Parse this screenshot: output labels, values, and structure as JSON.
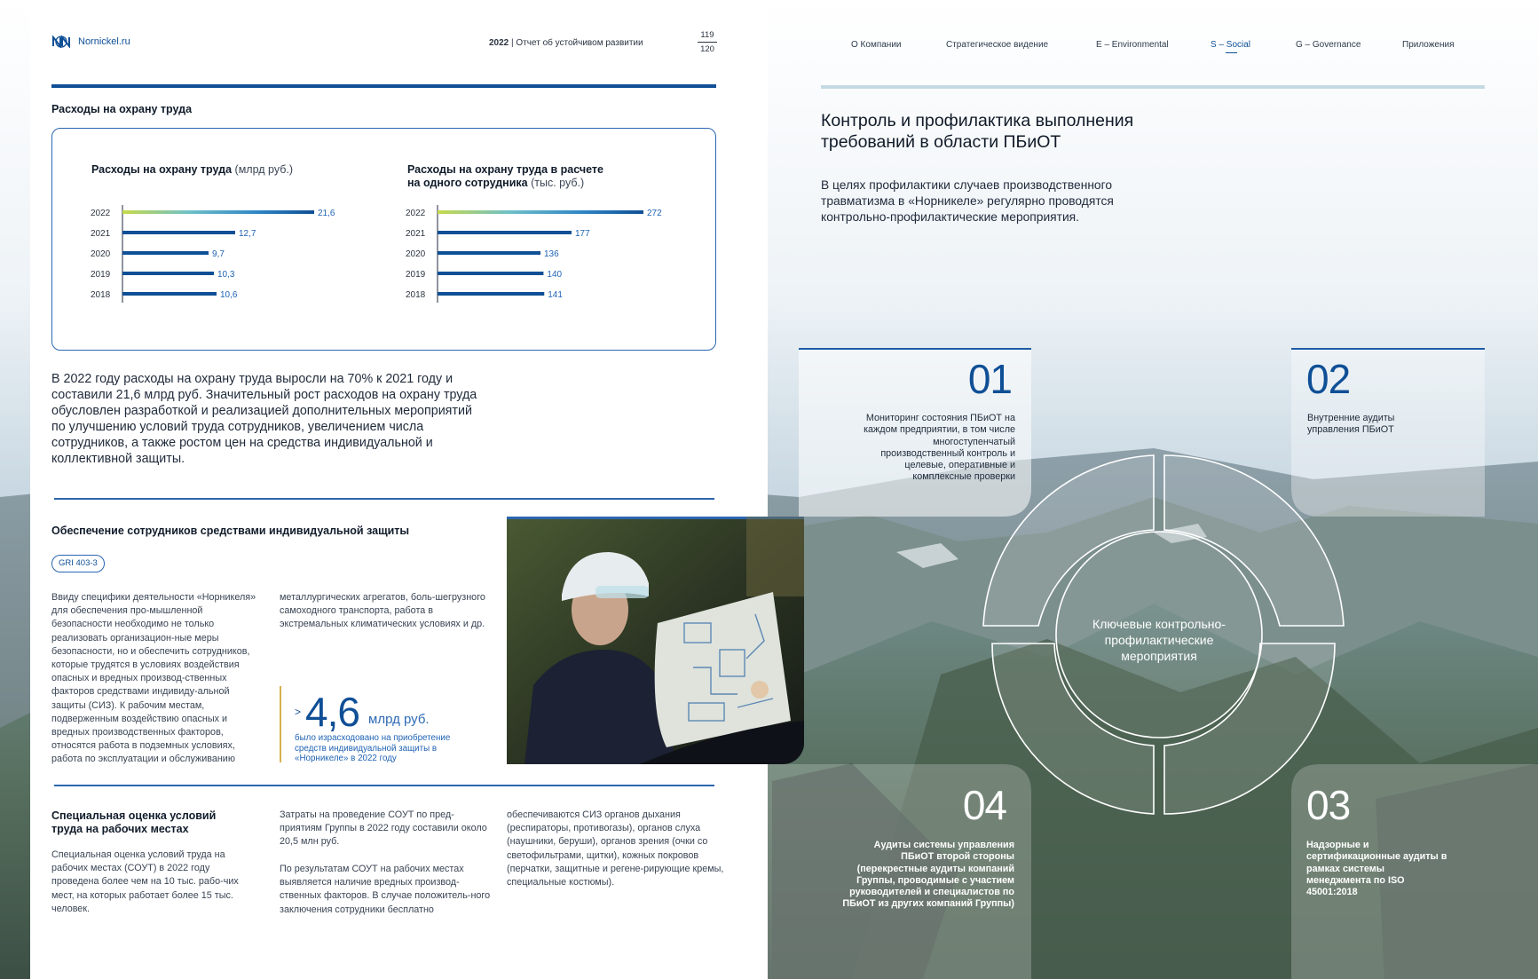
{
  "header": {
    "site": "Nornickel.ru",
    "report_year": "2022",
    "report_name": "Отчет об устойчивом развитии",
    "page_left": "119",
    "page_right": "120"
  },
  "nav": [
    {
      "label": "О Компании"
    },
    {
      "label": "Стратегическое видение"
    },
    {
      "label": "E – Environmental"
    },
    {
      "label": "S – Social"
    },
    {
      "label": "G – Governance"
    },
    {
      "label": "Приложения"
    }
  ],
  "left": {
    "section_title": "Расходы на охрану труда",
    "chart1_title": "Расходы на охрану труда",
    "chart1_unit": "(млрд руб.)",
    "chart2_title_line1": "Расходы на охрану труда в расчете",
    "chart2_title_line2": "на одного сотрудника",
    "chart2_unit": "(тыс. руб.)",
    "paragraph": "В 2022 году расходы на охрану труда выросли на 70% к 2021 году и составили 21,6 млрд руб. Значительный рост расходов на охрану труда обусловлен разработкой и реализацией дополнительных мероприятий по улучшению условий труда сотрудников, увеличением числа сотрудников, а также ростом цен на средства индивидуальной и коллективной защиты.",
    "ppe_title": "Обеспечение сотрудников средствами индивидуальной защиты",
    "gri_badge": "GRI 403-3",
    "ppe_col1": "Ввиду специфики деятельности «Норникеля» для обеспечения про-мышленной безопасности необходимо не только реализовать организацион-ные меры безопасности, но и обеспечить сотрудников, которые трудятся в условиях воздействия опасных и вредных производ-ственных факторов средствами индивиду-альной защиты (СИЗ). К рабочим местам, подверженным воздействию опасных и вредных производственных факторов, относятся работа в подземных условиях, работа по эксплуатации и обслуживанию",
    "ppe_col2": "металлургических агрегатов, боль-шегрузного самоходного транспорта, работа в экстремальных климатических условиях и др.",
    "stat_arrow": ">",
    "stat_value": "4,6",
    "stat_unit": "млрд руб.",
    "stat_caption": "было израсходовано на приобретение средств индивидуальной защиты в «Норникеле» в 2022 году",
    "soutu_title": "Специальная оценка условий труда на рабочих местах",
    "soutu_col1": "Специальная оценка условий труда на рабочих местах (СОУТ) в 2022 году проведена более чем на 10 тыс. рабо-чих мест, на которых работает более 15 тыс. человек.",
    "soutu_col2a": "Затраты на проведение СОУТ по пред-приятиям Группы в 2022 году составили около 20,5 млн руб.",
    "soutu_col2b": "По результатам СОУТ на рабочих местах выявляется наличие вредных производ-ственных факторов. В случае положитель-ного заключения сотрудники бесплатно",
    "soutu_col3": "обеспечиваются СИЗ органов дыхания (респираторы, противогазы), органов слуха (наушники, беруши), органов зрения (очки со светофильтрами, щитки), кожных покровов (перчатки, защитные и регене-рирующие кремы, специальные костюмы)."
  },
  "right": {
    "title": "Контроль и профилактика выполнения требований в области ПБиОТ",
    "intro": "В целях профилактики случаев производственного травматизма в «Норникеле» регулярно проводятся контрольно-профилактические мероприятия.",
    "center_label": "Ключевые контрольно-профилактические мероприятия",
    "cards": [
      {
        "num": "01",
        "text": "Мониторинг состояния ПБиОТ на каждом предприятии, в том числе многоступенчатый производственный контроль и целевые, оперативные и комплексные проверки"
      },
      {
        "num": "02",
        "text": "Внутренние аудиты управления ПБиОТ"
      },
      {
        "num": "03",
        "text": "Надзорные и сертификационные аудиты в рамках системы менеджмента по ISO 45001:2018"
      },
      {
        "num": "04",
        "text": "Аудиты системы управления ПБиОТ второй стороны (перекрестные аудиты компаний Группы, проводимые с участием руководителей и специалистов по ПБиОТ из других компаний Группы)"
      }
    ]
  },
  "chart_data": [
    {
      "type": "bar",
      "title": "Расходы на охрану труда (млрд руб.)",
      "categories": [
        "2022",
        "2021",
        "2020",
        "2019",
        "2018"
      ],
      "values": [
        21.6,
        12.7,
        9.7,
        10.3,
        10.6
      ],
      "labels": [
        "21,6",
        "12,7",
        "9,7",
        "10,3",
        "10,6"
      ]
    },
    {
      "type": "bar",
      "title": "Расходы на охрану труда в расчете на одного сотрудника (тыс. руб.)",
      "categories": [
        "2022",
        "2021",
        "2020",
        "2019",
        "2018"
      ],
      "values": [
        272,
        177,
        136,
        140,
        141
      ],
      "labels": [
        "272",
        "177",
        "136",
        "140",
        "141"
      ]
    }
  ]
}
